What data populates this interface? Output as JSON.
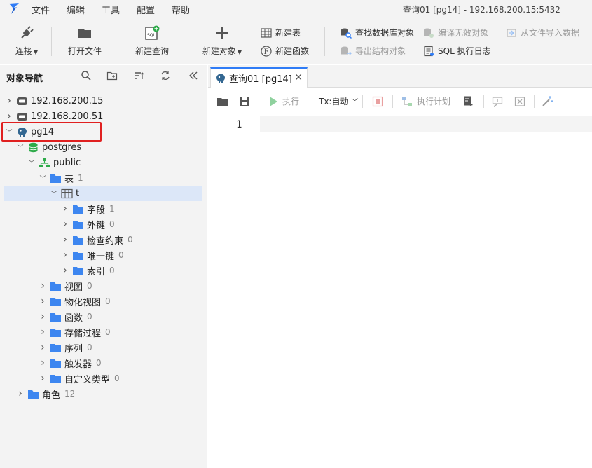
{
  "menu": {
    "items": [
      "文件",
      "编辑",
      "工具",
      "配置",
      "帮助"
    ]
  },
  "window_title": "查询01 [pg14]  - 192.168.200.15:5432",
  "toolbar": {
    "connect": "连接",
    "open_file": "打开文件",
    "new_query": "新建查询",
    "new_object": "新建对象",
    "new_table": "新建表",
    "new_function": "新建函数",
    "find_db_object": "查找数据库对象",
    "compile_invalid": "编译无效对象",
    "import_from_file": "从文件导入数据",
    "export_structure": "导出结构对象",
    "sql_log": "SQL 执行日志"
  },
  "navigator": {
    "title": "对象导航",
    "tree": [
      {
        "label": "192.168.200.15",
        "count": "",
        "type": "server",
        "expanded": false
      },
      {
        "label": "192.168.200.51",
        "count": "",
        "type": "server",
        "expanded": false
      },
      {
        "label": "pg14",
        "count": "",
        "type": "pg",
        "expanded": true
      },
      {
        "label": "postgres",
        "count": "",
        "type": "db",
        "expanded": true
      },
      {
        "label": "public",
        "count": "",
        "type": "schema",
        "expanded": true
      },
      {
        "label": "表",
        "count": "1",
        "type": "folder",
        "expanded": true
      },
      {
        "label": "t",
        "count": "",
        "type": "table",
        "expanded": true,
        "selected": true
      },
      {
        "label": "字段",
        "count": "1",
        "type": "folder",
        "expanded": false
      },
      {
        "label": "外键",
        "count": "0",
        "type": "folder",
        "expanded": false
      },
      {
        "label": "检查约束",
        "count": "0",
        "type": "folder",
        "expanded": false
      },
      {
        "label": "唯一键",
        "count": "0",
        "type": "folder",
        "expanded": false
      },
      {
        "label": "索引",
        "count": "0",
        "type": "folder",
        "expanded": false
      },
      {
        "label": "视图",
        "count": "0",
        "type": "folder",
        "expanded": false
      },
      {
        "label": "物化视图",
        "count": "0",
        "type": "folder",
        "expanded": false
      },
      {
        "label": "函数",
        "count": "0",
        "type": "folder",
        "expanded": false
      },
      {
        "label": "存储过程",
        "count": "0",
        "type": "folder",
        "expanded": false
      },
      {
        "label": "序列",
        "count": "0",
        "type": "folder",
        "expanded": false
      },
      {
        "label": "触发器",
        "count": "0",
        "type": "folder",
        "expanded": false
      },
      {
        "label": "自定义类型",
        "count": "0",
        "type": "folder",
        "expanded": false
      },
      {
        "label": "角色",
        "count": "12",
        "type": "folder",
        "expanded": false
      }
    ]
  },
  "tab": {
    "label": "查询01 [pg14]"
  },
  "query_toolbar": {
    "execute": "执行",
    "tx_mode": "Tx:自动",
    "explain": "执行计划"
  },
  "editor": {
    "line_number": "1"
  },
  "colors": {
    "accent": "#2f7cf6",
    "folder": "#3d86f0",
    "highlight": "#e02020",
    "selected_row": "#dce7f8"
  }
}
